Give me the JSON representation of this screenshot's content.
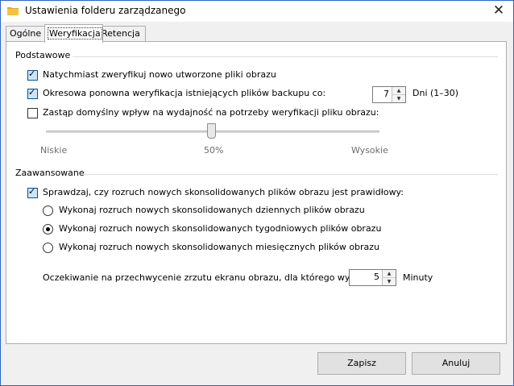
{
  "window": {
    "title": "Ustawienia folderu zarządzanego",
    "close_glyph": "✕"
  },
  "tabs": [
    {
      "label": "Ogólne"
    },
    {
      "label": "Weryfikacja"
    },
    {
      "label": "Retencja"
    }
  ],
  "basic": {
    "group_title": "Podstawowe",
    "verify_new": {
      "label": "Natychmiast zweryfikuj nowo utworzone pliki obrazu",
      "checked": true
    },
    "periodic": {
      "label": "Okresowa ponowna weryfikacja istniejących plików backupu co:",
      "checked": true,
      "value": "7",
      "unit": "Dni (1–30)"
    },
    "override": {
      "label": "Zastąp domyślny wpływ na wydajność na potrzeby weryfikacji pliku obrazu:",
      "checked": false
    },
    "slider": {
      "min_label": "Niskie",
      "mid_label": "50%",
      "max_label": "Wysokie",
      "level_percent": 50
    }
  },
  "advanced": {
    "group_title": "Zaawansowane",
    "check_rollup": {
      "label": "Sprawdzaj, czy rozruch nowych skonsolidowanych plików obrazu jest prawidłowy:",
      "checked": true
    },
    "options": [
      {
        "label": "Wykonaj rozruch nowych skonsolidowanych dziennych plików obrazu",
        "selected": false
      },
      {
        "label": "Wykonaj rozruch nowych skonsolidowanych tygodniowych plików obrazu",
        "selected": true
      },
      {
        "label": "Wykonaj rozruch nowych skonsolidowanych miesięcznych plików obrazu",
        "selected": false
      }
    ],
    "wait": {
      "label": "Oczekiwanie na przechwycenie zrzutu ekranu obrazu, dla którego wykona",
      "value": "5",
      "unit": "Minuty"
    }
  },
  "buttons": {
    "save": "Zapisz",
    "cancel": "Anuluj"
  },
  "colors": {
    "accent": "#005499",
    "title_border": "#2f64c8",
    "folder_icon": "#e8a820"
  }
}
